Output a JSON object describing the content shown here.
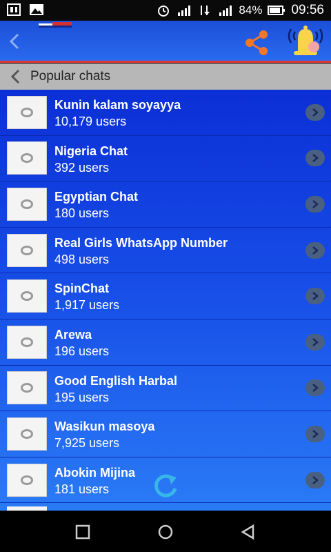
{
  "status_bar": {
    "battery": "84%",
    "time": "09:56"
  },
  "section": {
    "title": "Popular chats"
  },
  "chats": [
    {
      "name": "Kunin kalam soyayya",
      "users": "10,179 users"
    },
    {
      "name": "Nigeria Chat",
      "users": "392 users"
    },
    {
      "name": "Egyptian Chat",
      "users": "180 users"
    },
    {
      "name": "Real Girls WhatsApp Number",
      "users": "498 users"
    },
    {
      "name": "SpinChat",
      "users": "1,917 users"
    },
    {
      "name": "Arewa",
      "users": "196 users"
    },
    {
      "name": "Good English Harbal",
      "users": "195 users"
    },
    {
      "name": "Wasikun masoya",
      "users": "7,925 users"
    },
    {
      "name": "Abokin Mijina",
      "users": "181 users"
    }
  ],
  "colors": {
    "accent_red": "#e53935",
    "list_blue": "#1850e8",
    "header_gray": "#b7b7b7"
  }
}
